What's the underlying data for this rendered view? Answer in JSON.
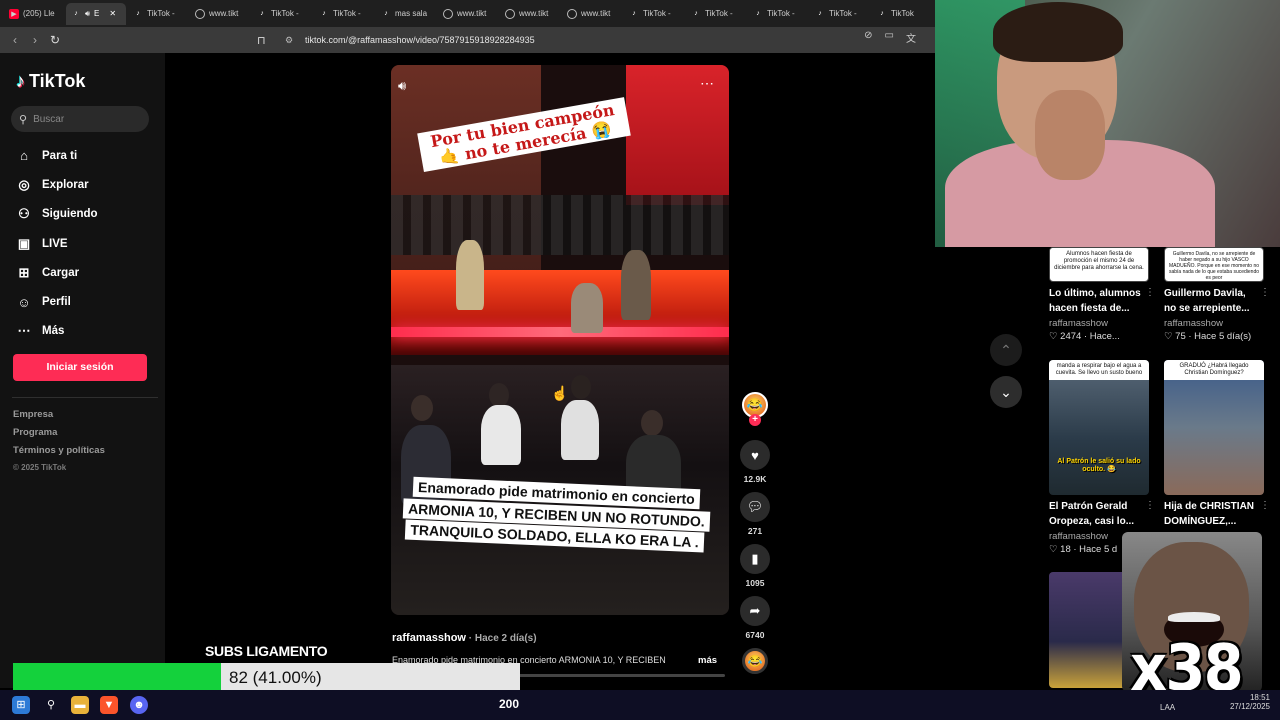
{
  "browser": {
    "tabs": [
      {
        "label": "(205) Lle",
        "fav": "yt"
      },
      {
        "label": "E",
        "fav": "tt",
        "active": true
      },
      {
        "label": "TikTok -",
        "fav": "tt"
      },
      {
        "label": "www.tikt",
        "fav": "globe"
      },
      {
        "label": "TikTok -",
        "fav": "tt"
      },
      {
        "label": "TikTok -",
        "fav": "tt"
      },
      {
        "label": "mas sala",
        "fav": "tt"
      },
      {
        "label": "www.tikt",
        "fav": "globe"
      },
      {
        "label": "www.tikt",
        "fav": "globe"
      },
      {
        "label": "www.tikt",
        "fav": "globe"
      },
      {
        "label": "TikTok -",
        "fav": "tt"
      },
      {
        "label": "TikTok -",
        "fav": "tt"
      },
      {
        "label": "TikTok -",
        "fav": "tt"
      },
      {
        "label": "TikTok -",
        "fav": "tt"
      },
      {
        "label": "TikTok",
        "fav": "tt"
      }
    ],
    "url": "tiktok.com/@raffamasshow/video/7587915918928284935"
  },
  "sidebar": {
    "logo": "TikTok",
    "search_placeholder": "Buscar",
    "menu": [
      {
        "label": "Para ti",
        "icon": "⌂",
        "name": "home-icon"
      },
      {
        "label": "Explorar",
        "icon": "◎",
        "name": "compass-icon"
      },
      {
        "label": "Siguiendo",
        "icon": "⚇",
        "name": "following-icon"
      },
      {
        "label": "LIVE",
        "icon": "▣",
        "name": "live-icon"
      },
      {
        "label": "Cargar",
        "icon": "⊞",
        "name": "upload-icon"
      },
      {
        "label": "Perfil",
        "icon": "☺",
        "name": "profile-icon"
      },
      {
        "label": "Más",
        "icon": "⋯",
        "name": "more-icon"
      }
    ],
    "login": "Iniciar sesión",
    "footer": [
      "Empresa",
      "Programa",
      "Términos y políticas"
    ],
    "copyright": "© 2025 TikTok"
  },
  "video": {
    "caption_top": "Por tu bien campeón 🤙 no te merecía 😭",
    "caption_bottom": "Enamorado pide matrimonio en concierto ARMONIA 10, Y RECIBEN UN NO ROTUNDO. TRANQUILO SOLDADO, ELLA KO ERA LA .",
    "author": "raffamasshow",
    "ago": " · Hace 2 día(s)",
    "description": "Enamorado pide matrimonio en concierto ARMONIA 10, Y RECIBEN",
    "more": "más",
    "likes": "12.9K",
    "comments": "271",
    "saves": "1095",
    "shares": "6740"
  },
  "related": [
    {
      "title": "Lo último, alumnos hacen fiesta de...",
      "user": "raffamasshow",
      "meta": "♡ 2474 · Hace...",
      "thumb_text": "Alumnos hacen fiesta de promoción el mismo 24 de diciembre para ahorrarse la cena."
    },
    {
      "title": "Guillermo Davila, no se arrepiente...",
      "user": "raffamasshow",
      "meta": "♡ 75 · Hace 5 día(s)",
      "thumb_text": "Guillermo Davila, no se arrepiente de haber negado a su hijo VASCO MADUEÑO. Porque en ese momento no sabía nada de lo que estaba sucediendo es peor"
    },
    {
      "title": "El Patrón Gerald Oropeza, casi lo...",
      "user": "raffamasshow",
      "meta": "♡ 18 · Hace 5 d",
      "thumb_text": "manda a respirar bajo el agua a cuevita. Se llevo un susto bueno",
      "overlay": "Al Patrón le salió su lado oculto. 😂"
    },
    {
      "title": "Hija de CHRISTIAN DOMÍNGUEZ,...",
      "user": "",
      "meta": "",
      "thumb_text": "GRADUÓ ¿Habrá llegado Christian Domínguez?"
    }
  ],
  "overlay": {
    "subs_title": "SUBS LIGAMENTO",
    "subs_progress": 0.41,
    "subs_text": "82 (41.00%)",
    "laugh_count": "x38"
  },
  "taskbar": {
    "count": "200",
    "lang": "LAA",
    "time": "18:51",
    "date": "27/12/2025"
  }
}
